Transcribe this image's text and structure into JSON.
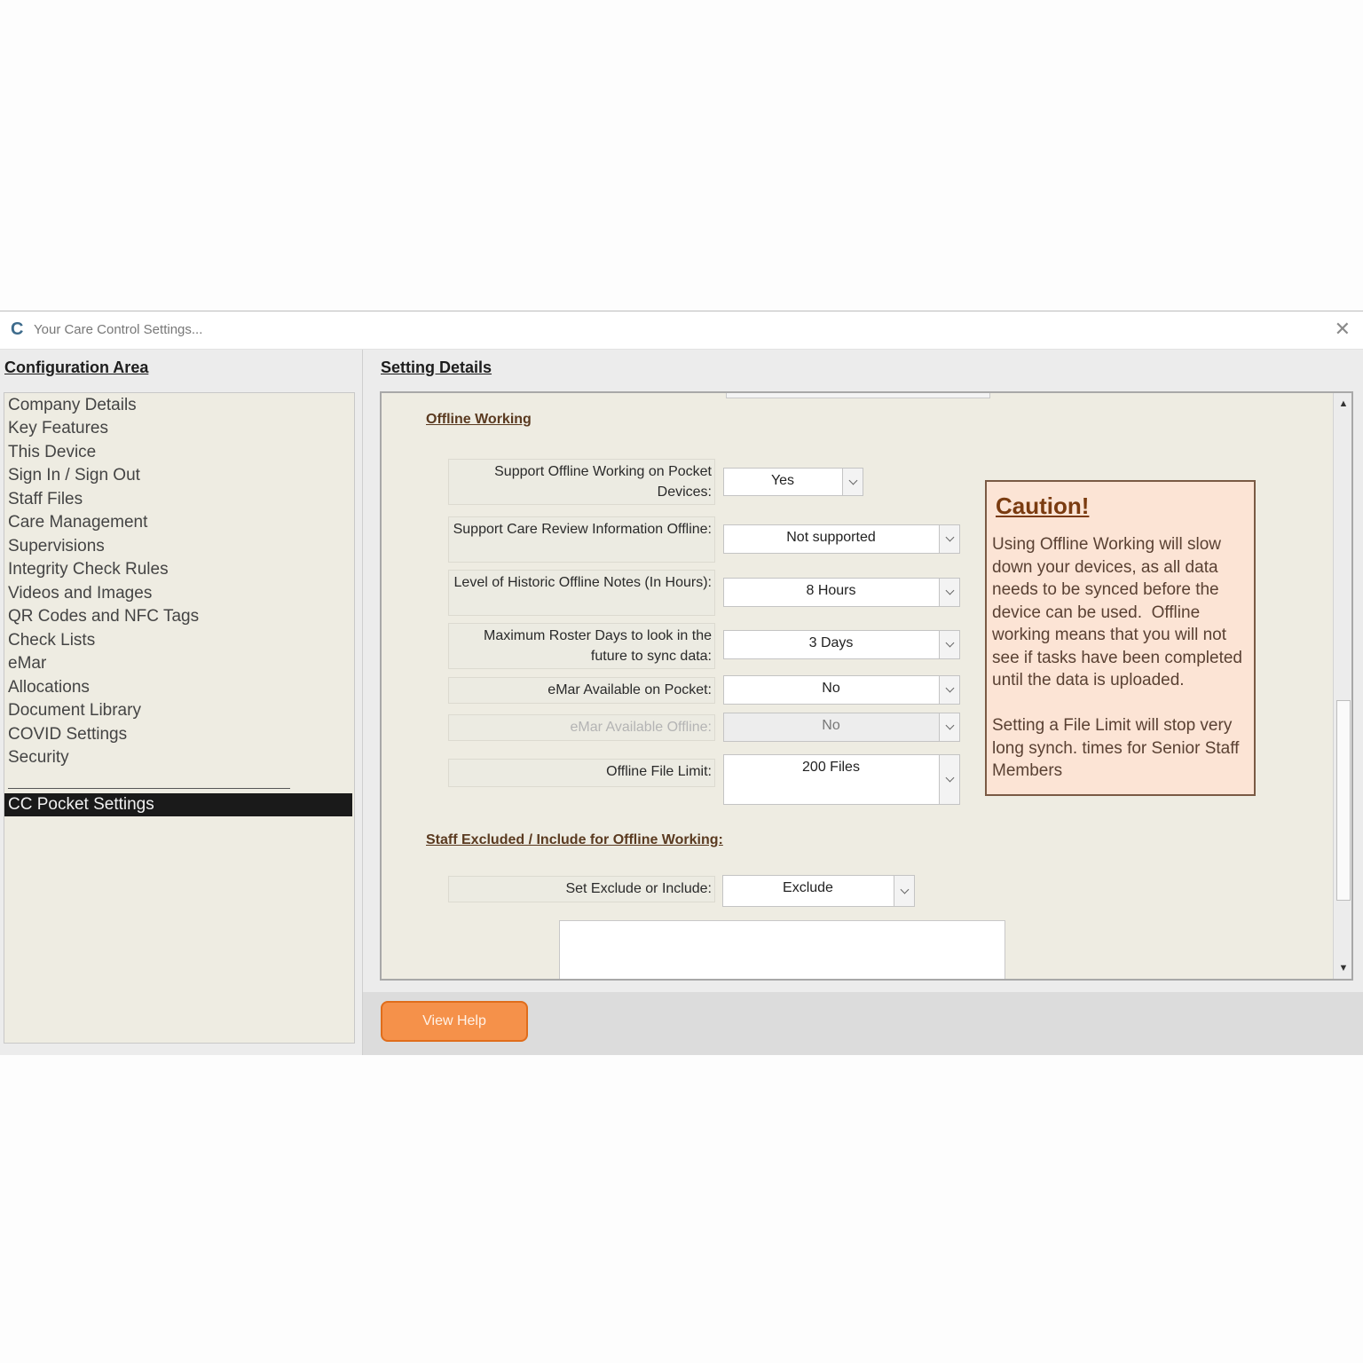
{
  "window": {
    "title": "Your Care Control Settings..."
  },
  "left": {
    "header": "Configuration Area",
    "items": [
      {
        "label": "Company Details"
      },
      {
        "label": "Key Features"
      },
      {
        "label": "This Device"
      },
      {
        "label": "Sign In / Sign Out"
      },
      {
        "label": "Staff Files"
      },
      {
        "label": "Care Management"
      },
      {
        "label": "Supervisions"
      },
      {
        "label": "Integrity Check Rules"
      },
      {
        "label": "Videos and Images"
      },
      {
        "label": "QR Codes and NFC Tags"
      },
      {
        "label": "Check Lists"
      },
      {
        "label": "eMar"
      },
      {
        "label": "Allocations"
      },
      {
        "label": "Document Library"
      },
      {
        "label": "COVID Settings"
      },
      {
        "label": "Security"
      },
      {
        "label": "CC Pocket Settings",
        "selected": true
      }
    ]
  },
  "right": {
    "header": "Setting Details",
    "offline": {
      "heading": "Offline Working",
      "rows": [
        {
          "label": "Support Offline Working on Pocket Devices:",
          "value": "Yes"
        },
        {
          "label": "Support Care Review Information Offline:",
          "value": "Not supported"
        },
        {
          "label": "Level of Historic Offline Notes (In Hours):",
          "value": "8 Hours"
        },
        {
          "label": "Maximum Roster Days to look in the future to sync data:",
          "value": "3 Days"
        },
        {
          "label": "eMar Available on Pocket:",
          "value": "No"
        },
        {
          "label": "eMar Available Offline:",
          "value": "No",
          "disabled": true
        },
        {
          "label": "Offline File Limit:",
          "value": "200 Files"
        }
      ]
    },
    "caution": {
      "title": "Caution!",
      "body": "Using Offline Working will slow down your devices, as all data needs to be synced before the device can be used.  Offline working means that you will not see if tasks have been completed until the data is uploaded.\n\nSetting a File Limit will stop very long synch. times for Senior Staff Members"
    },
    "staff": {
      "heading": "Staff Excluded / Include for Offline Working:",
      "row": {
        "label": "Set Exclude or Include:",
        "value": "Exclude"
      }
    }
  },
  "footer": {
    "help_label": "View Help"
  },
  "colors": {
    "accent": "#f5914a",
    "caution_bg": "#fce4d5",
    "selected_bg": "#1a1a1a",
    "panel_bg": "#eeece2"
  },
  "icons": {
    "app": "care-control-logo-icon",
    "close": "close-icon",
    "dropdown": "chevron-down-icon"
  }
}
